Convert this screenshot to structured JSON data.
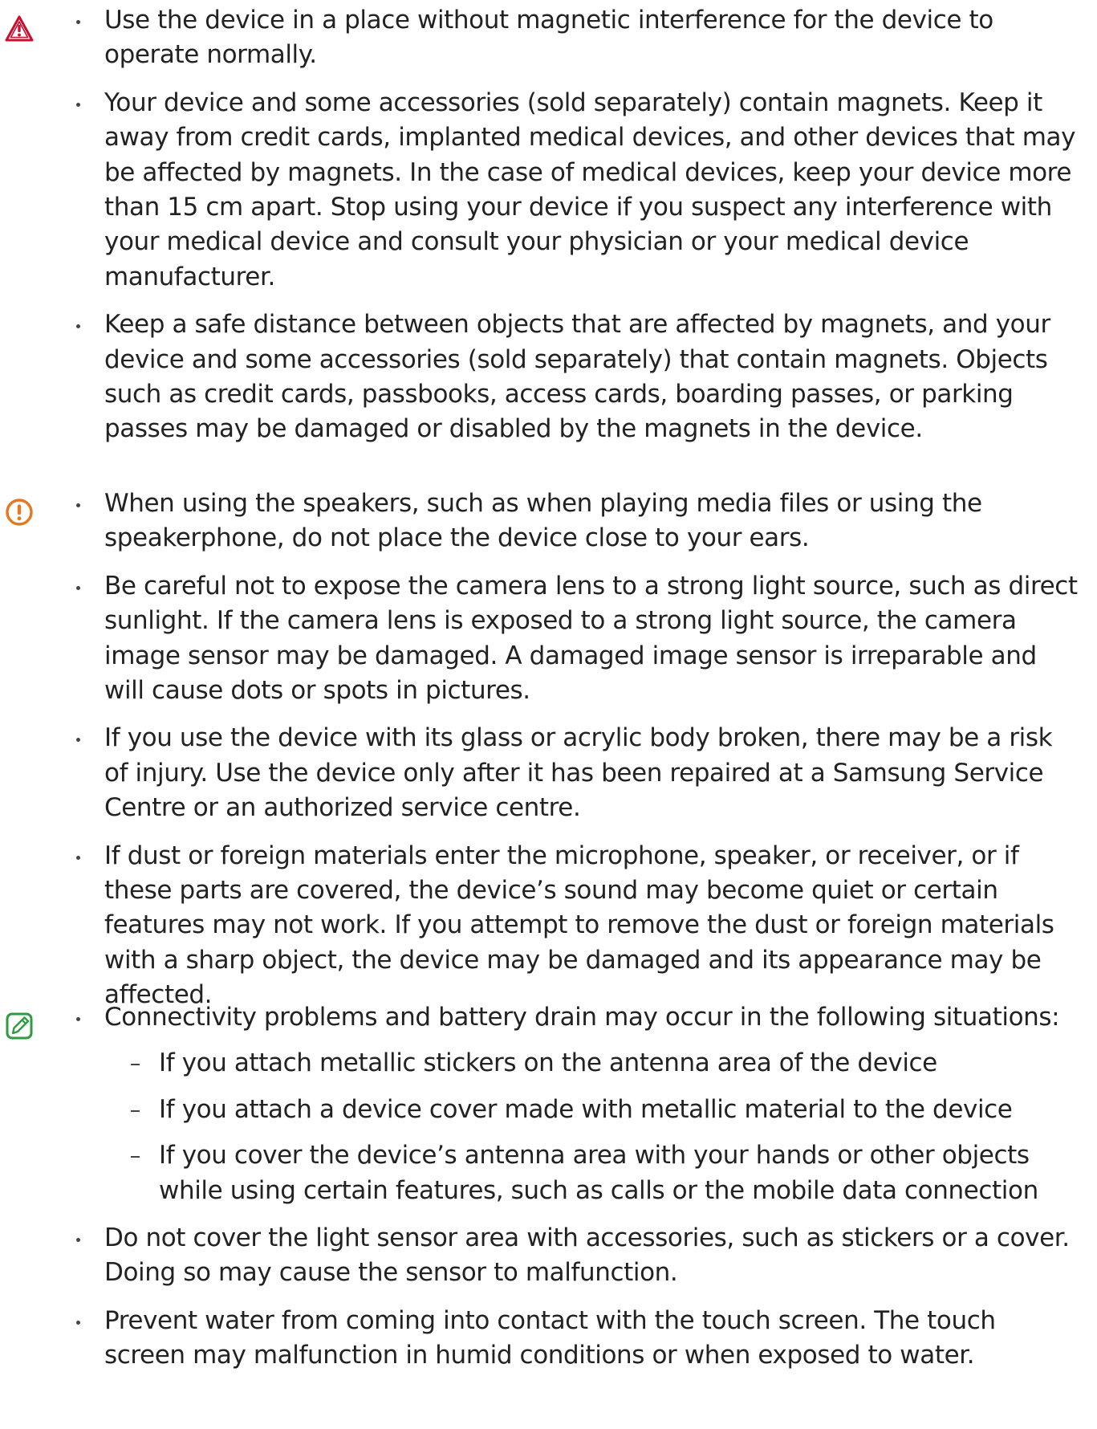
{
  "colors": {
    "warning": "#c8102e",
    "caution": "#e87722",
    "note": "#2e9b3e",
    "text": "#222222"
  },
  "blocks": [
    {
      "icon": "warning-triangle-icon",
      "bullets": [
        "Use the device in a place without magnetic interference for the device to operate normally.",
        "Your device and some accessories (sold separately) contain magnets. Keep it away from credit cards, implanted medical devices, and other devices that may be affected by magnets. In the case of medical devices, keep your device more than 15 cm apart. Stop using your device if you suspect any interference with your medical device and consult your physician or your medical device manufacturer.",
        "Keep a safe distance between objects that are affected by magnets, and your device and some accessories (sold separately) that contain magnets. Objects such as credit cards, passbooks, access cards, boarding passes, or parking passes may be damaged or disabled by the magnets in the device."
      ]
    },
    {
      "icon": "caution-exclamation-icon",
      "bullets": [
        "When using the speakers, such as when playing media files or using the speakerphone, do not place the device close to your ears.",
        "Be careful not to expose the camera lens to a strong light source, such as direct sunlight. If the camera lens is exposed to a strong light source, the camera image sensor may be damaged. A damaged image sensor is irreparable and will cause dots or spots in pictures.",
        "If you use the device with its glass or acrylic body broken, there may be a risk of injury. Use the device only after it has been repaired at a Samsung Service Centre or an authorized service centre.",
        "If dust or foreign materials enter the microphone, speaker, or receiver, or if these parts are covered, the device’s sound may become quiet or certain features may not work. If you attempt to remove the dust or foreign materials with a sharp object, the device may be damaged and its appearance may be affected."
      ]
    },
    {
      "icon": "note-pencil-icon",
      "bullets": [
        "Connectivity problems and battery drain may occur in the following situations:",
        "Do not cover the light sensor area with accessories, such as stickers or a cover. Doing so may cause the sensor to malfunction.",
        "Prevent water from coming into contact with the touch screen. The touch screen may malfunction in humid conditions or when exposed to water."
      ],
      "subitems": [
        "If you attach metallic stickers on the antenna area of the device",
        "If you attach a device cover made with metallic material to the device",
        "If you cover the device’s antenna area with your hands or other objects while using certain features, such as calls or the mobile data connection"
      ]
    }
  ]
}
